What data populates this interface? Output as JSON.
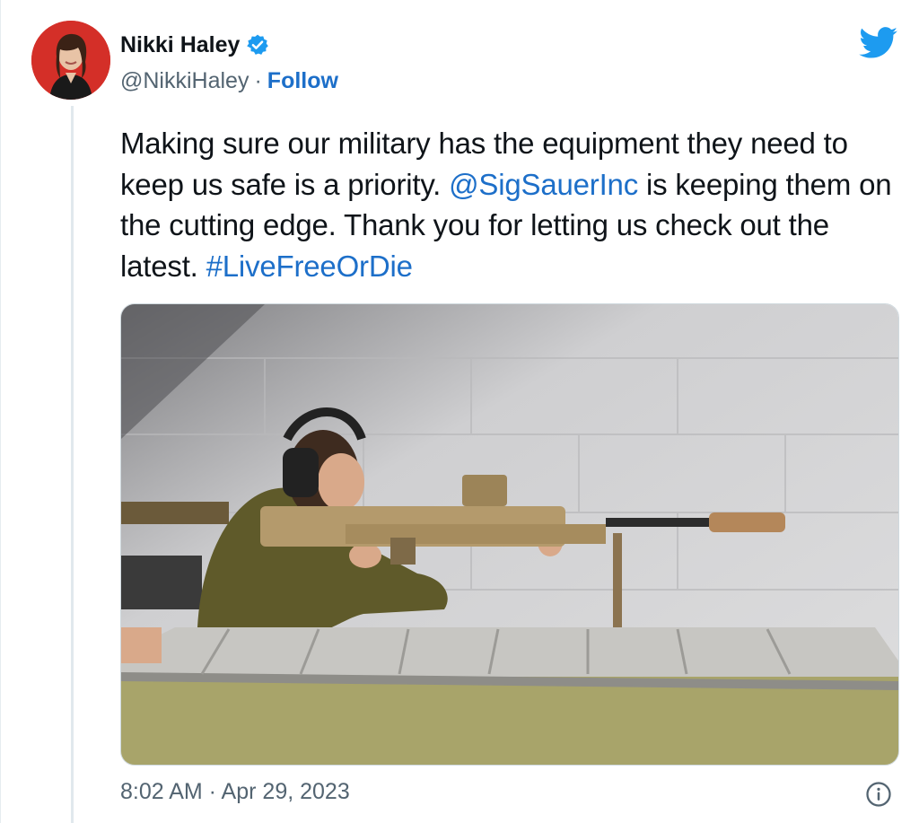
{
  "tweet": {
    "display_name": "Nikki Haley",
    "handle": "@NikkiHaley",
    "separator": "·",
    "follow_label": "Follow",
    "text_segments": [
      "Making sure our military has the equipment they need to keep us safe is a priority. ",
      "@SigSauerInc",
      " is keeping them on the cutting edge. Thank you for letting us check out the latest. ",
      "#LiveFreeOrDie"
    ],
    "timestamp": "8:02 AM · Apr 29, 2023"
  },
  "icons": {
    "verified": "verified-badge-icon",
    "brand": "twitter-bird-icon",
    "info": "info-icon"
  },
  "colors": {
    "link": "#1d6fc9",
    "verified": "#1d9bf0",
    "brand": "#1d9bf0",
    "secondary_text": "#536471"
  }
}
